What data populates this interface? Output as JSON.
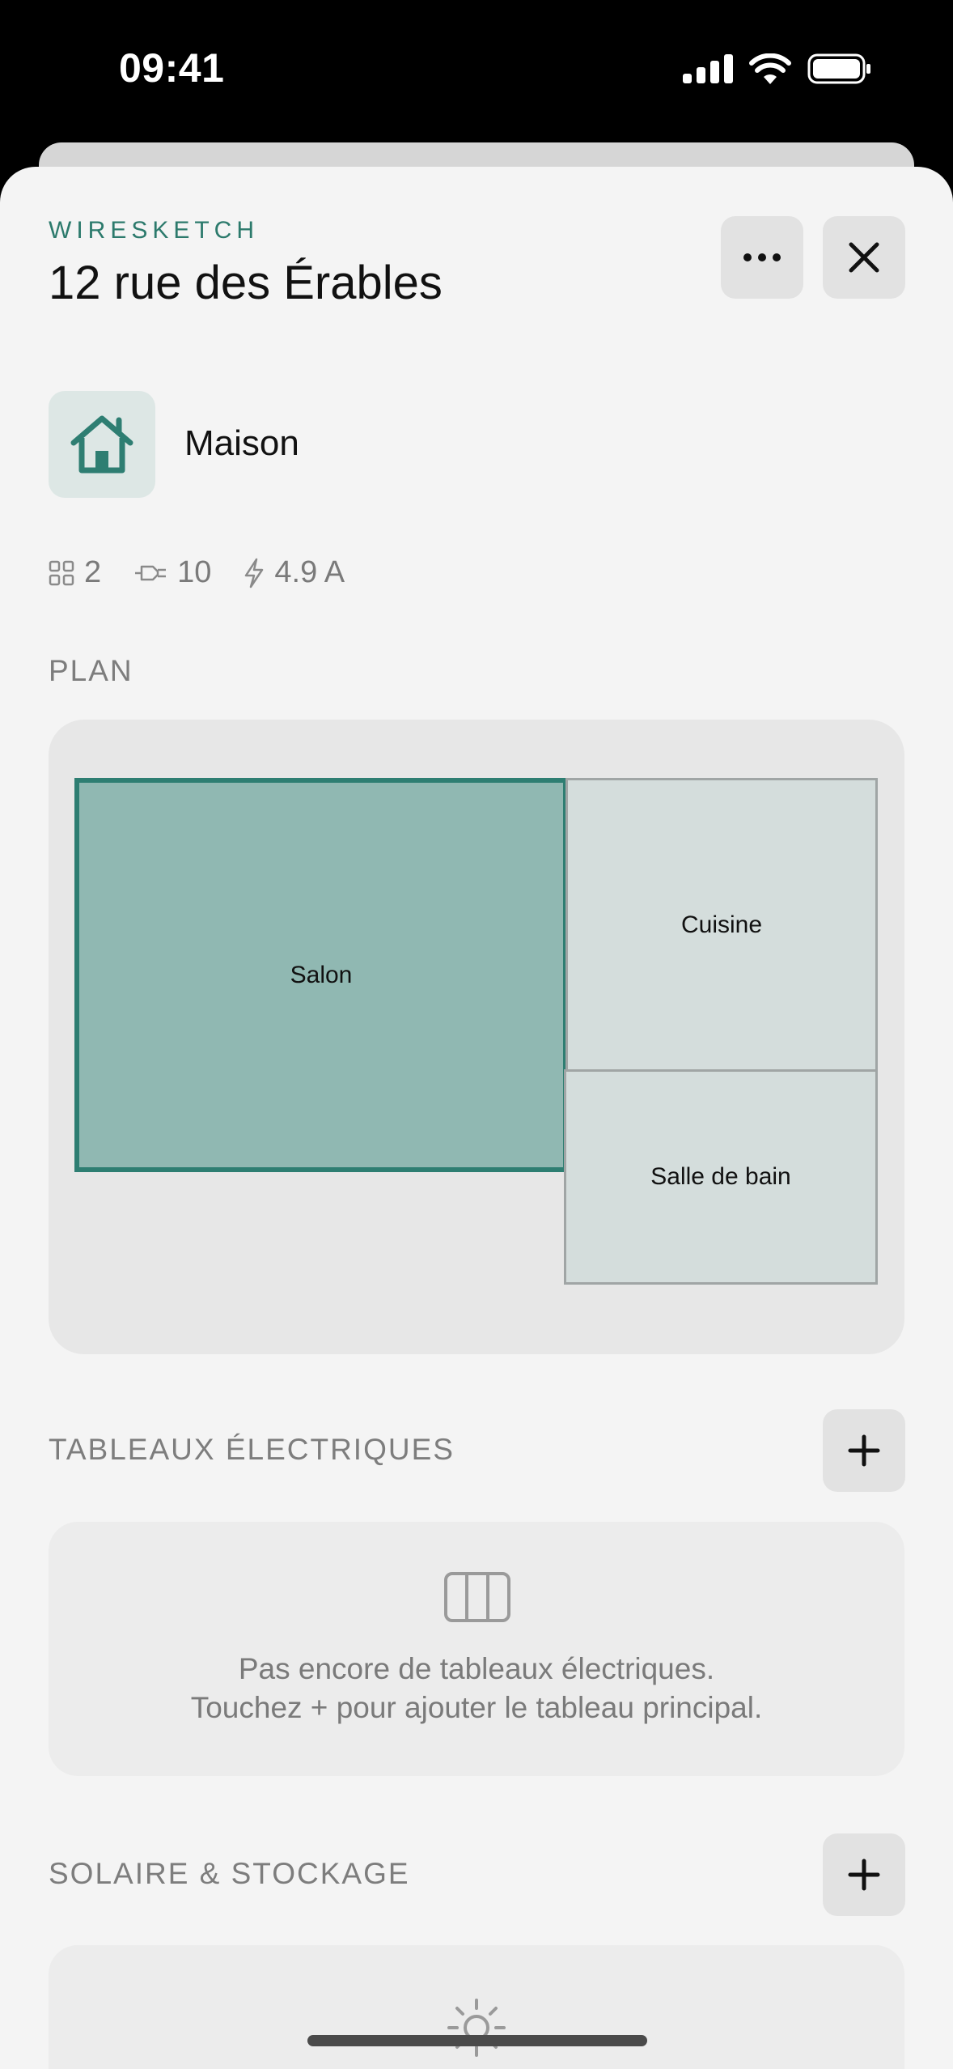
{
  "status": {
    "time": "09:41"
  },
  "header": {
    "brand": "WIRESKETCH",
    "title": "12 rue des Érables"
  },
  "property": {
    "type_label": "Maison"
  },
  "stats": {
    "rooms": "2",
    "outlets": "10",
    "current": "4.9 A"
  },
  "plan": {
    "label": "PLAN",
    "rooms": [
      {
        "name": "Salon",
        "selected": true
      },
      {
        "name": "Cuisine",
        "selected": false
      },
      {
        "name": "Salle de bain",
        "selected": false
      }
    ]
  },
  "panels": {
    "label": "TABLEAUX ÉLECTRIQUES",
    "empty_line1": "Pas encore de tableaux électriques.",
    "empty_line2": "Touchez + pour ajouter le tableau principal."
  },
  "solar": {
    "label": "SOLAIRE & STOCKAGE"
  },
  "colors": {
    "accent": "#2e7e72",
    "selected_room": "#90b8b2",
    "room": "#d4dddc"
  }
}
